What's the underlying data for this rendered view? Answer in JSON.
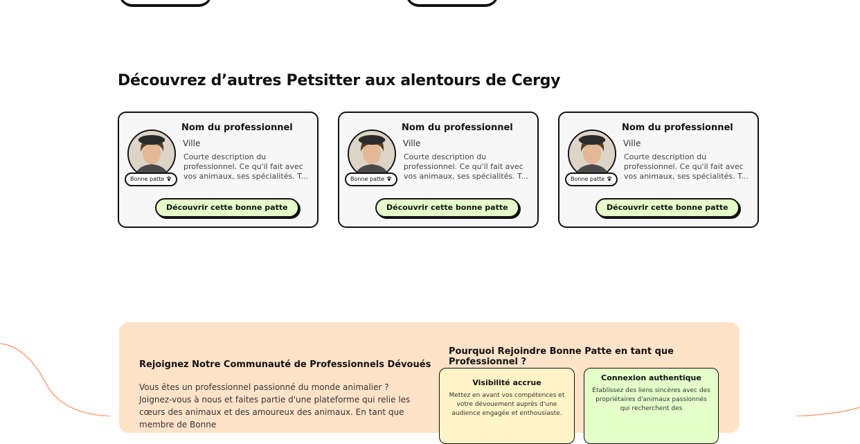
{
  "section": {
    "title": "Découvrez d’autres Petsitter aux alentours de Cergy"
  },
  "cards": [
    {
      "name": "Nom du professionnel",
      "city": "Ville",
      "description": "Courte description du professionnel. Ce qu'il fait avec vos animaux, ses spécialités. T...",
      "badge": "Bonne patte",
      "button": "Découvrir cette bonne patte"
    },
    {
      "name": "Nom du professionnel",
      "city": "Ville",
      "description": "Courte description du professionnel. Ce qu'il fait avec vos animaux, ses spécialités. T...",
      "badge": "Bonne patte",
      "button": "Découvrir cette bonne patte"
    },
    {
      "name": "Nom du professionnel",
      "city": "Ville",
      "description": "Courte description du professionnel. Ce qu'il fait avec vos animaux, ses spécialités. T...",
      "badge": "Bonne patte",
      "button": "Découvrir cette bonne patte"
    }
  ],
  "join": {
    "title": "Rejoignez Notre Communauté de Professionnels Dévoués",
    "text": "Vous êtes un professionnel passionné du monde animalier ? Joignez-vous à nous et faites partie d'une plateforme qui relie les cœurs des animaux et des amoureux des animaux. En tant que membre de Bonne",
    "why_title": "Pourquoi Rejoindre Bonne Patte en tant que Professionnel ?",
    "benefits": [
      {
        "title": "Visibilité accrue",
        "text": "Mettez en avant vos compétences et votre dévouement auprès d'une audience engagée et enthousiaste."
      },
      {
        "title": "Connexion authentique",
        "text": "Établissez des liens sincères avec des propriétaires d'animaux passionnés qui recherchent des"
      }
    ]
  },
  "colors": {
    "card_bg": "#f7f7f7",
    "button_bg": "#e4ffc9",
    "join_bg": "#ffe3c9",
    "benefit_yellow": "#fff4c6",
    "benefit_green": "#e4ffc9",
    "curve": "#f7a27a"
  },
  "icons": {
    "badge_icon": "paw-icon"
  }
}
